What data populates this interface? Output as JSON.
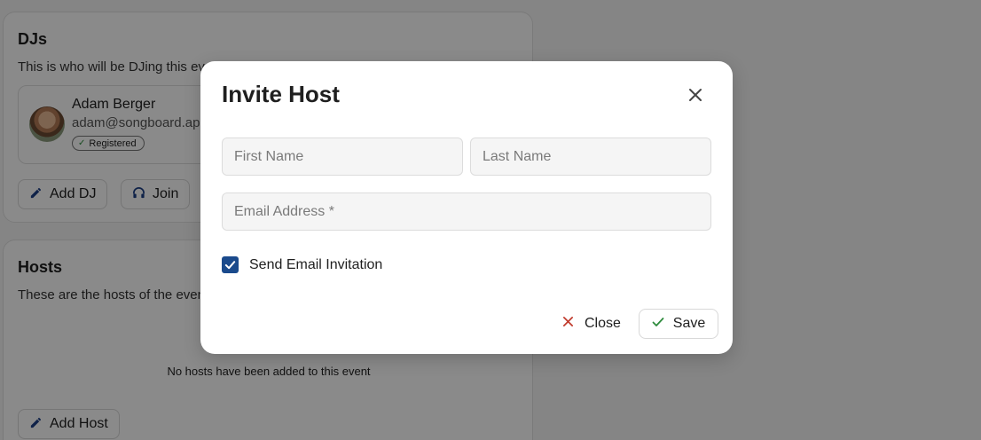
{
  "djs_card": {
    "title": "DJs",
    "description": "This is who will be DJing this event",
    "dj": {
      "name": "Adam Berger",
      "email": "adam@songboard.app",
      "status": "Registered"
    },
    "add_dj_label": "Add DJ",
    "join_label": "Join"
  },
  "hosts_card": {
    "title": "Hosts",
    "description": "These are the hosts of the event",
    "empty_message": "No hosts have been added to this event",
    "add_host_label": "Add Host"
  },
  "modal": {
    "title": "Invite Host",
    "first_name_placeholder": "First Name",
    "last_name_placeholder": "Last Name",
    "email_placeholder": "Email Address *",
    "first_name_value": "",
    "last_name_value": "",
    "email_value": "",
    "send_invitation_label": "Send Email Invitation",
    "send_invitation_checked": true,
    "close_label": "Close",
    "save_label": "Save"
  },
  "colors": {
    "accent": "#1a4a8c",
    "close_icon": "#c0392b",
    "save_icon": "#2e8b3d"
  },
  "icons": {
    "add_dj": "pencil-icon",
    "join": "headphones-icon",
    "add_host": "pencil-icon",
    "modal_close": "close-icon",
    "close_button": "x-icon",
    "save_button": "check-icon"
  }
}
